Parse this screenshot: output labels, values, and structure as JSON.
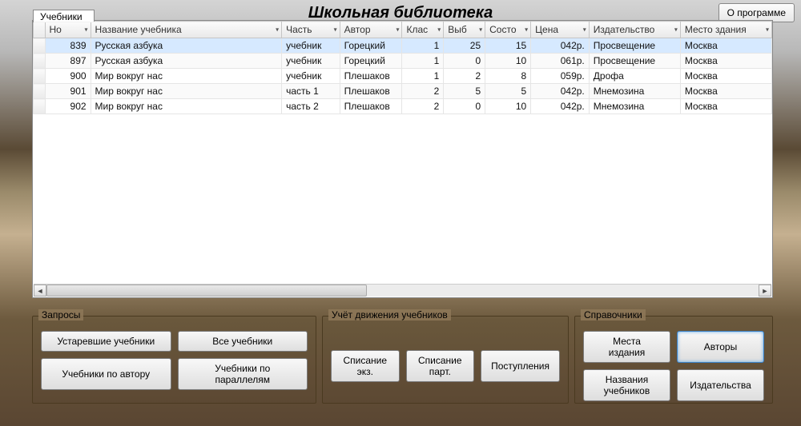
{
  "title": "Школьная библиотека",
  "about": "О программе",
  "tab": "Учебники",
  "columns": [
    "Но",
    "Название учебника",
    "Часть",
    "Автор",
    "Клас",
    "Выб",
    "Состо",
    "Цена",
    "Издательство",
    "Место здания"
  ],
  "rows": [
    {
      "no": "839",
      "name": "Русская азбука",
      "part": "учебник",
      "author": "Горецкий",
      "klass": "1",
      "vyb": "25",
      "sost": "15",
      "price": "042р.",
      "pub": "Просвещение",
      "place": "Москва",
      "selected": true
    },
    {
      "no": "897",
      "name": "Русская азбука",
      "part": "учебник",
      "author": "Горецкий",
      "klass": "1",
      "vyb": "0",
      "sost": "10",
      "price": "061р.",
      "pub": "Просвещение",
      "place": "Москва"
    },
    {
      "no": "900",
      "name": "Мир вокруг нас",
      "part": "учебник",
      "author": "Плешаков",
      "klass": "1",
      "vyb": "2",
      "sost": "8",
      "price": "059р.",
      "pub": "Дрофа",
      "place": "Москва"
    },
    {
      "no": "901",
      "name": "Мир вокруг нас",
      "part": "часть 1",
      "author": "Плешаков",
      "klass": "2",
      "vyb": "5",
      "sost": "5",
      "price": "042р.",
      "pub": "Мнемозина",
      "place": "Москва"
    },
    {
      "no": "902",
      "name": "Мир вокруг нас",
      "part": "часть 2",
      "author": "Плешаков",
      "klass": "2",
      "vyb": "0",
      "sost": "10",
      "price": "042р.",
      "pub": "Мнемозина",
      "place": "Москва"
    }
  ],
  "groups": {
    "queries": {
      "title": "Запросы",
      "btns": [
        "Устаревшие учебники",
        "Все учебники",
        "Учебники по автору",
        "Учебники по параллелям"
      ]
    },
    "movement": {
      "title": "Учёт движения учебников",
      "btns": [
        "Списание экз.",
        "Списание парт.",
        "Поступления"
      ]
    },
    "dirs": {
      "title": "Справочники",
      "btns": [
        "Места издания",
        "Авторы",
        "Названия учебников",
        "Издательства"
      ],
      "active": 1
    }
  }
}
